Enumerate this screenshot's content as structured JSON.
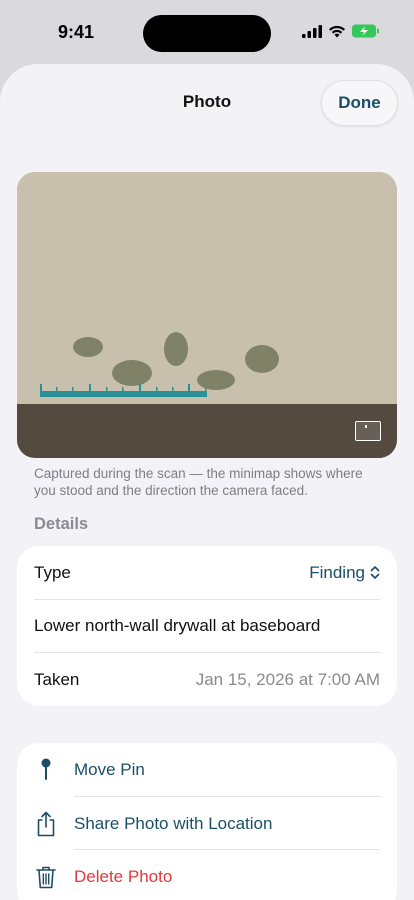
{
  "status_bar": {
    "time": "9:41"
  },
  "sheet": {
    "title": "Photo",
    "done_label": "Done"
  },
  "photo": {
    "caption": "Captured during the scan — the minimap shows where you stood and the direction the camera faced."
  },
  "details": {
    "header": "Details",
    "type_label": "Type",
    "type_value": "Finding",
    "description": "Lower north-wall drywall at baseboard",
    "taken_label": "Taken",
    "taken_value": "Jan 15, 2026 at 7:00 AM"
  },
  "actions": {
    "move_pin": "Move Pin",
    "share": "Share Photo with Location",
    "delete": "Delete Photo"
  },
  "colors": {
    "accent": "#1b4e66",
    "destructive": "#e5383b",
    "ruler": "#2a9197",
    "wall": "#c8c0ad",
    "floor": "#544a3f",
    "spots": "#7f8266",
    "battery": "#35c759"
  }
}
